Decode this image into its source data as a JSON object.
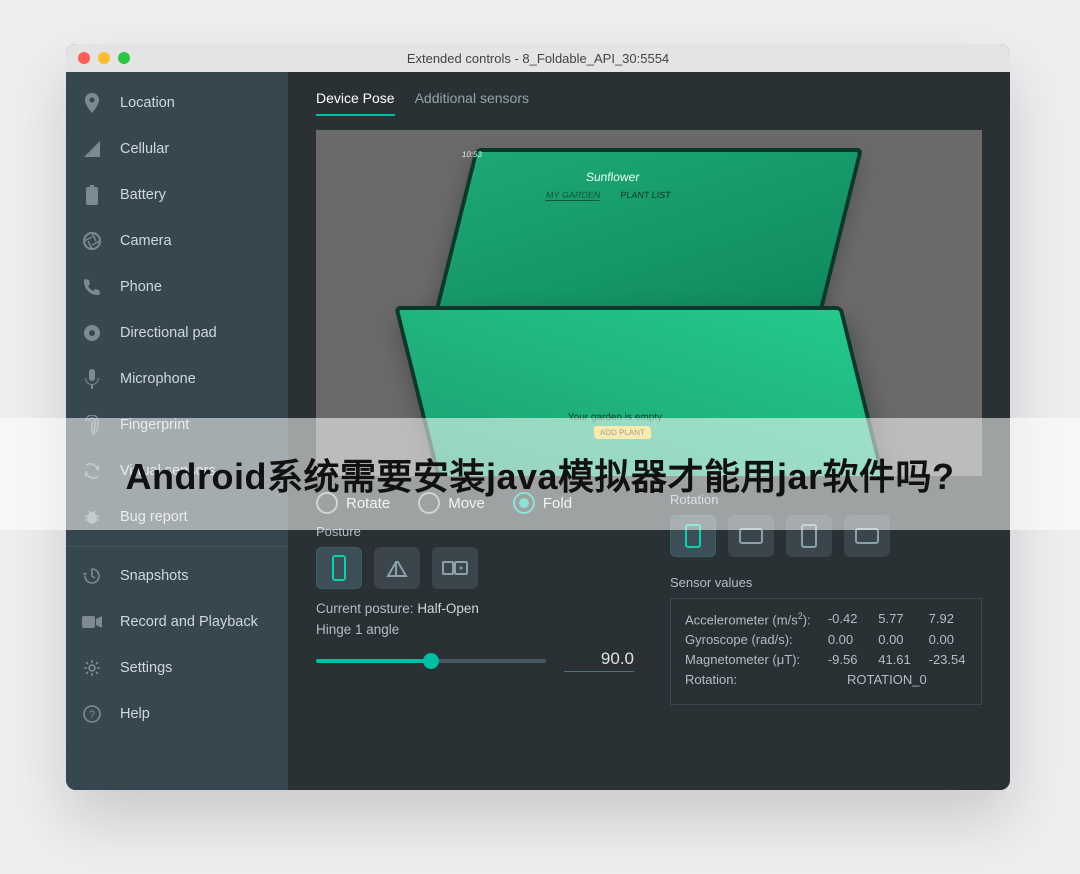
{
  "window": {
    "title": "Extended controls - 8_Foldable_API_30:5554"
  },
  "sidebar": {
    "items": [
      {
        "label": "Location",
        "icon": "location-icon"
      },
      {
        "label": "Cellular",
        "icon": "signal-icon"
      },
      {
        "label": "Battery",
        "icon": "battery-icon"
      },
      {
        "label": "Camera",
        "icon": "shutter-icon"
      },
      {
        "label": "Phone",
        "icon": "phone-icon"
      },
      {
        "label": "Directional pad",
        "icon": "dpad-icon"
      },
      {
        "label": "Microphone",
        "icon": "mic-icon"
      },
      {
        "label": "Fingerprint",
        "icon": "fingerprint-icon"
      },
      {
        "label": "Virtual sensors",
        "icon": "rotate-icon"
      },
      {
        "label": "Bug report",
        "icon": "bug-icon"
      },
      {
        "label": "Snapshots",
        "icon": "history-icon"
      },
      {
        "label": "Record and Playback",
        "icon": "videocam-icon"
      },
      {
        "label": "Settings",
        "icon": "gear-icon"
      },
      {
        "label": "Help",
        "icon": "help-icon"
      }
    ],
    "divider_after_index": 9
  },
  "tabs": {
    "device_pose": "Device Pose",
    "additional_sensors": "Additional sensors",
    "active": "device_pose"
  },
  "preview": {
    "app_title": "Sunflower",
    "tab_my_garden": "MY GARDEN",
    "tab_plant_list": "PLANT LIST",
    "status_time": "10:53",
    "empty_text": "Your garden is empty",
    "add_button": "ADD PLANT"
  },
  "mode": {
    "rotate": "Rotate",
    "move": "Move",
    "fold": "Fold",
    "selected": "fold"
  },
  "posture": {
    "label": "Posture",
    "current_label": "Current posture:",
    "current_value": "Half-Open",
    "hinge_label": "Hinge 1 angle",
    "hinge_value": "90.0"
  },
  "rotation": {
    "label": "Rotation",
    "selected_index": 0
  },
  "sensors": {
    "heading": "Sensor values",
    "accel_label": "Accelerometer (m/s",
    "accel_sup": "2",
    "accel_label_close": "):",
    "accel": [
      "-0.42",
      "5.77",
      "7.92"
    ],
    "gyro_label": "Gyroscope (rad/s):",
    "gyro": [
      "0.00",
      "0.00",
      "0.00"
    ],
    "mag_label": "Magnetometer (μT):",
    "mag": [
      "-9.56",
      "41.61",
      "-23.54"
    ],
    "rot_label": "Rotation:",
    "rot_value": "ROTATION_0"
  },
  "overlay": {
    "text": "Android系统需要安装java模拟器才能用jar软件吗?"
  }
}
